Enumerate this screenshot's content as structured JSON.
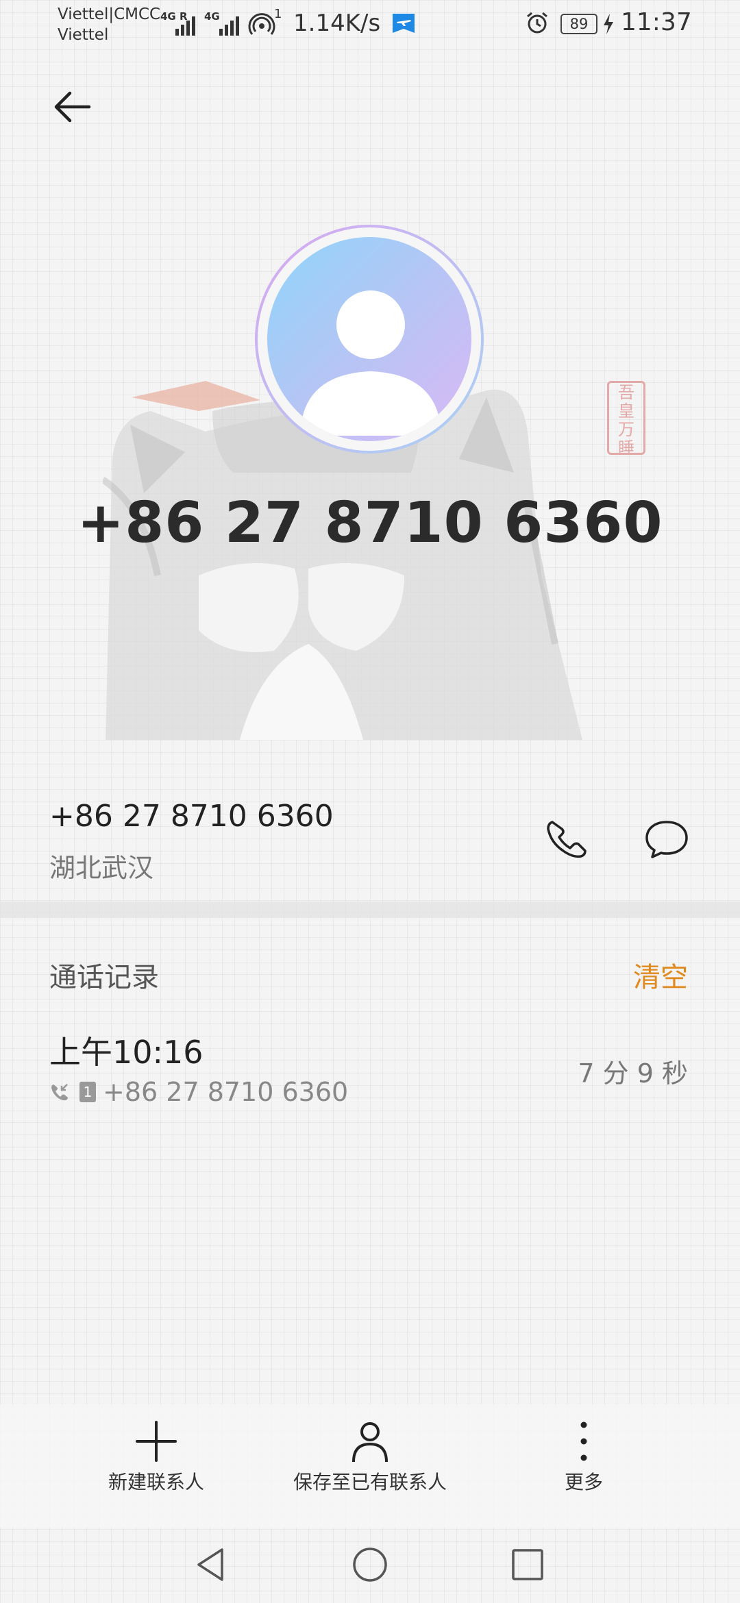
{
  "status_bar": {
    "carrier_1": "Viettel|CMCC",
    "carrier_2": "Viettel",
    "signal_1_label": "4G R",
    "signal_2_label": "4G",
    "hotspot_superscript": "1",
    "net_speed": "1.14K/s",
    "battery_level": "89",
    "time": "11:37"
  },
  "hero": {
    "number": "+86 27 8710 6360",
    "seal_text": [
      "吾",
      "皇",
      "万",
      "睡"
    ]
  },
  "contact": {
    "phone": "+86 27 8710 6360",
    "location": "湖北武汉"
  },
  "call_log": {
    "title": "通话记录",
    "clear_label": "清空",
    "entries": [
      {
        "time": "上午10:16",
        "sim": "1",
        "number": "+86 27 8710 6360",
        "duration": "7 分 9 秒"
      }
    ]
  },
  "actions": {
    "new_contact": "新建联系人",
    "save_existing": "保存至已有联系人",
    "more": "更多"
  },
  "colors": {
    "accent": "#e08a1e",
    "avatar_gradient_start": "#8fd5fa",
    "avatar_gradient_end": "#d9b8f5"
  },
  "icons": [
    "back-arrow-icon",
    "phone-icon",
    "message-icon",
    "plus-icon",
    "person-icon",
    "more-vertical-icon",
    "nav-back-icon",
    "nav-home-icon",
    "nav-recents-icon",
    "alarm-icon",
    "hotspot-icon",
    "signal-icon",
    "charging-icon"
  ]
}
